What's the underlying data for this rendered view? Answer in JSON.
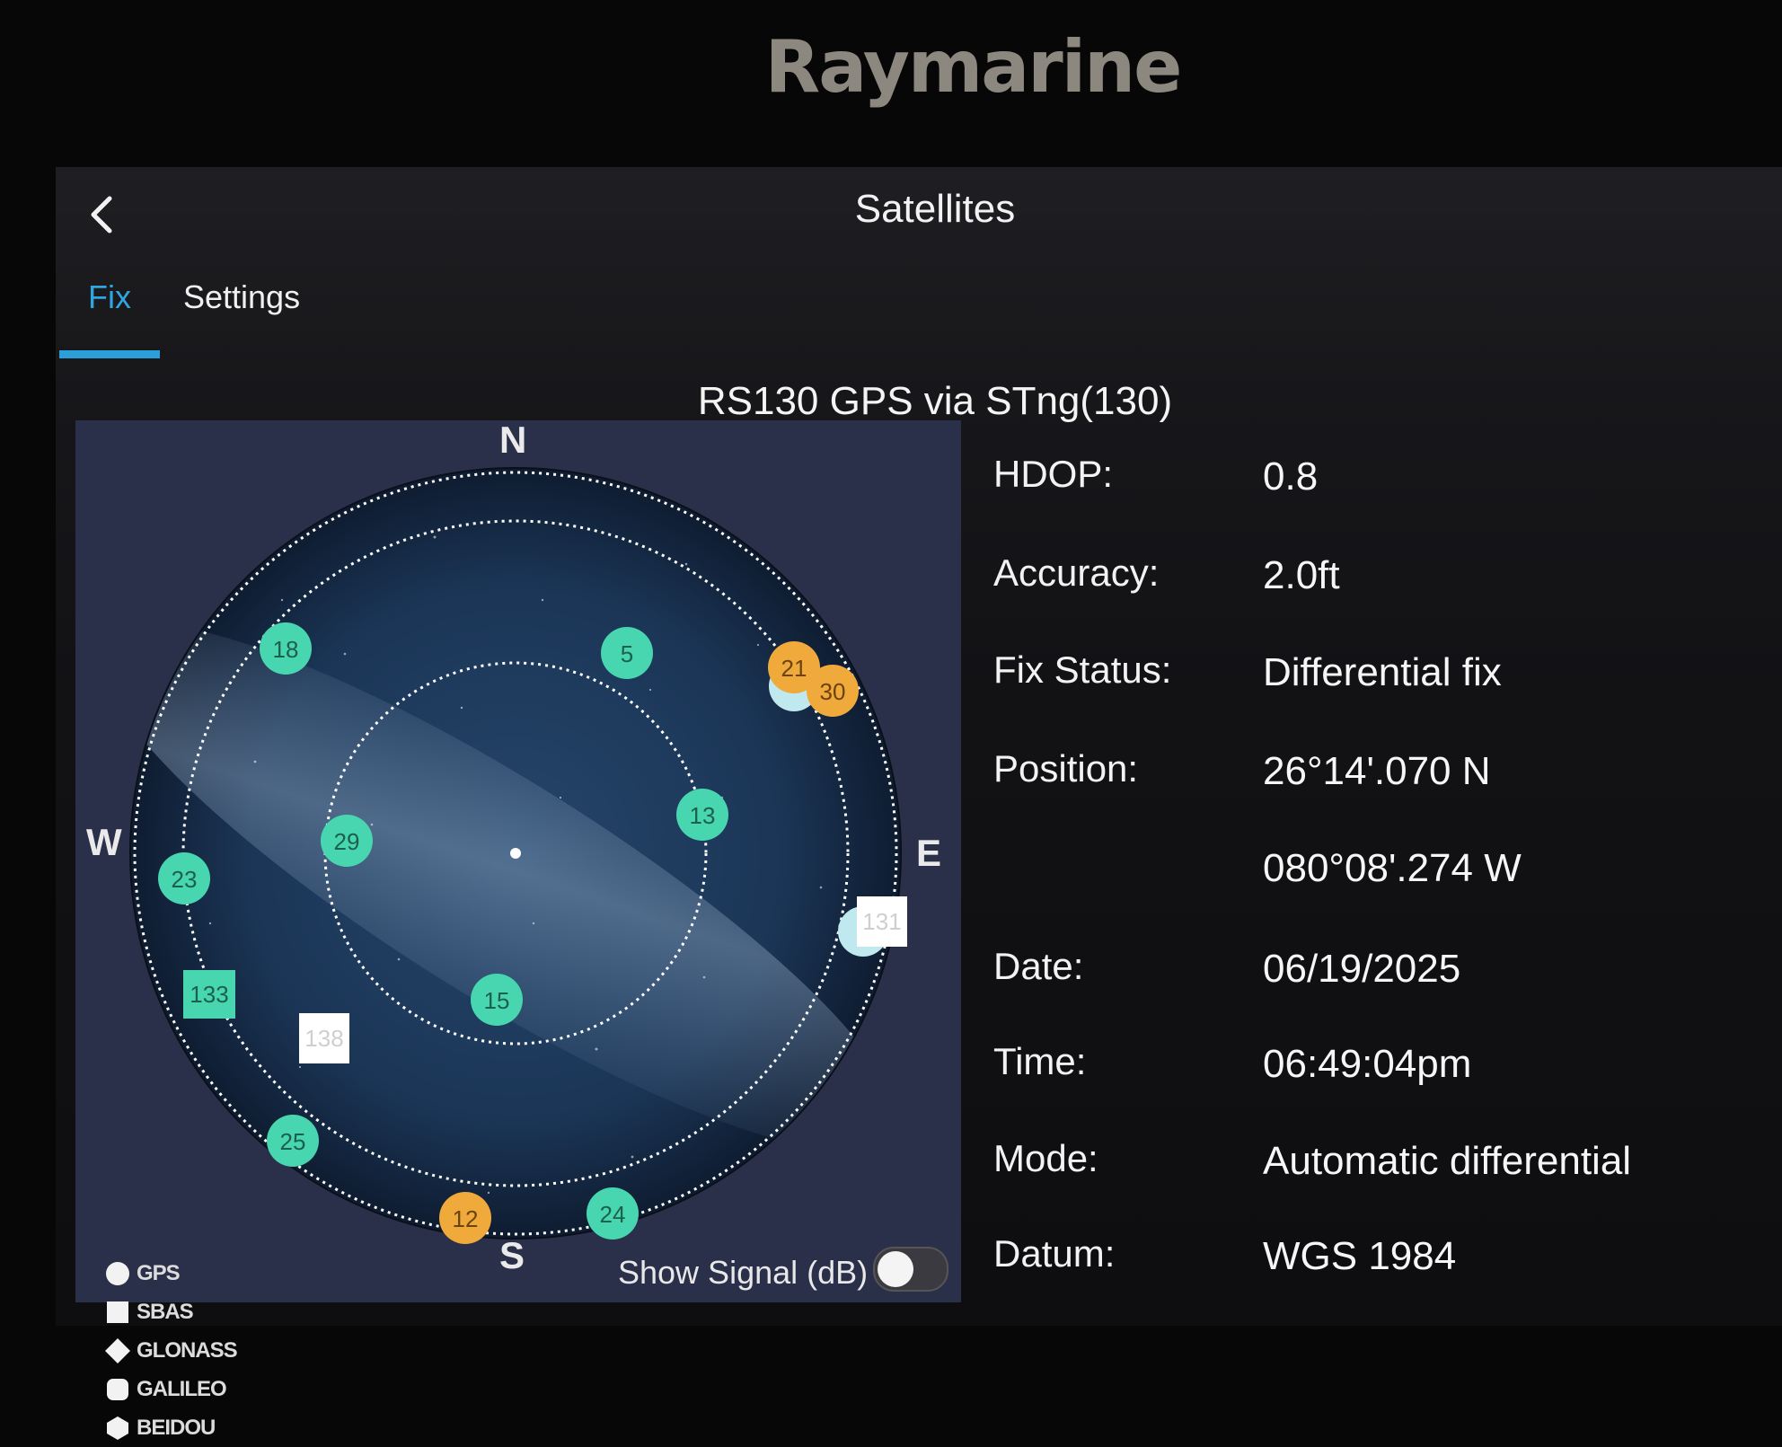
{
  "brand": "Raymarine",
  "header": {
    "title": "Satellites"
  },
  "tabs": [
    {
      "label": "Fix",
      "active": true
    },
    {
      "label": "Settings",
      "active": false
    }
  ],
  "device": "RS130 GPS via STng(130)",
  "compass": {
    "n": "N",
    "s": "S",
    "e": "E",
    "w": "W"
  },
  "satellites": [
    {
      "id": "18",
      "type": "GPS",
      "color": "#48d6b0"
    },
    {
      "id": "5",
      "type": "GPS",
      "color": "#48d6b0"
    },
    {
      "id": "21",
      "type": "GPS",
      "color": "#f0a93b"
    },
    {
      "id": "30",
      "type": "GPS",
      "color": "#f0a93b"
    },
    {
      "id": "13",
      "type": "GPS",
      "color": "#48d6b0"
    },
    {
      "id": "29",
      "type": "GPS",
      "color": "#48d6b0"
    },
    {
      "id": "23",
      "type": "GPS",
      "color": "#48d6b0"
    },
    {
      "id": "15",
      "type": "GPS",
      "color": "#48d6b0"
    },
    {
      "id": "133",
      "type": "SBAS",
      "color": "#48d6b0"
    },
    {
      "id": "138",
      "type": "SBAS",
      "color": "#ffffff"
    },
    {
      "id": "131",
      "type": "SBAS",
      "color": "#ffffff"
    },
    {
      "id": "25",
      "type": "GPS",
      "color": "#48d6b0"
    },
    {
      "id": "12",
      "type": "GPS",
      "color": "#f0a93b"
    },
    {
      "id": "24",
      "type": "GPS",
      "color": "#48d6b0"
    }
  ],
  "legend": [
    "GPS",
    "SBAS",
    "GLONASS",
    "GALILEO",
    "BEIDOU"
  ],
  "show_signal": {
    "label": "Show Signal (dB)",
    "enabled": false
  },
  "fix_info": {
    "hdop": {
      "label": "HDOP:",
      "value": "0.8"
    },
    "accuracy": {
      "label": "Accuracy:",
      "value": "2.0ft"
    },
    "fix_status": {
      "label": "Fix Status:",
      "value": "Differential fix"
    },
    "position": {
      "label": "Position:",
      "lat": "26°14'.070 N",
      "lon": "080°08'.274 W"
    },
    "date": {
      "label": "Date:",
      "value": "06/19/2025"
    },
    "time": {
      "label": "Time:",
      "value": "06:49:04pm"
    },
    "mode": {
      "label": "Mode:",
      "value": "Automatic differential"
    },
    "datum": {
      "label": "Datum:",
      "value": "WGS 1984"
    }
  },
  "colors": {
    "accent": "#2b9fd9",
    "sat_good": "#48d6b0",
    "sat_weak": "#f0a93b"
  }
}
